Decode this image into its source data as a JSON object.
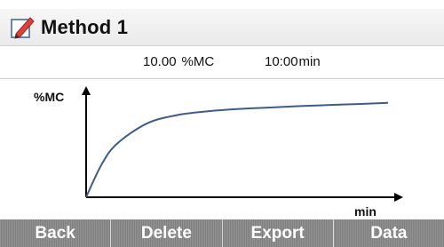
{
  "title_bar": {
    "title": "Method 1",
    "icon": "pencil-notepad-icon"
  },
  "info": {
    "moisture_value": "10.00",
    "moisture_unit": "%MC",
    "time_value": "10:00",
    "time_unit": "min"
  },
  "chart_data": {
    "type": "line",
    "ylabel": "%MC",
    "xlabel": "min",
    "series": [
      {
        "x": [
          0,
          0.5,
          1,
          2,
          3,
          4,
          5,
          6,
          7,
          8,
          9,
          10
        ],
        "values": [
          0,
          3.4,
          5.6,
          7.8,
          8.7,
          9.1,
          9.35,
          9.5,
          9.65,
          9.77,
          9.88,
          10.0
        ]
      }
    ],
    "xlim": [
      0,
      10
    ],
    "ylim": [
      0,
      11.3
    ],
    "line_color": "#3e5c8a"
  },
  "softkeys": {
    "back": "Back",
    "delete": "Delete",
    "export": "Export",
    "data": "Data"
  }
}
